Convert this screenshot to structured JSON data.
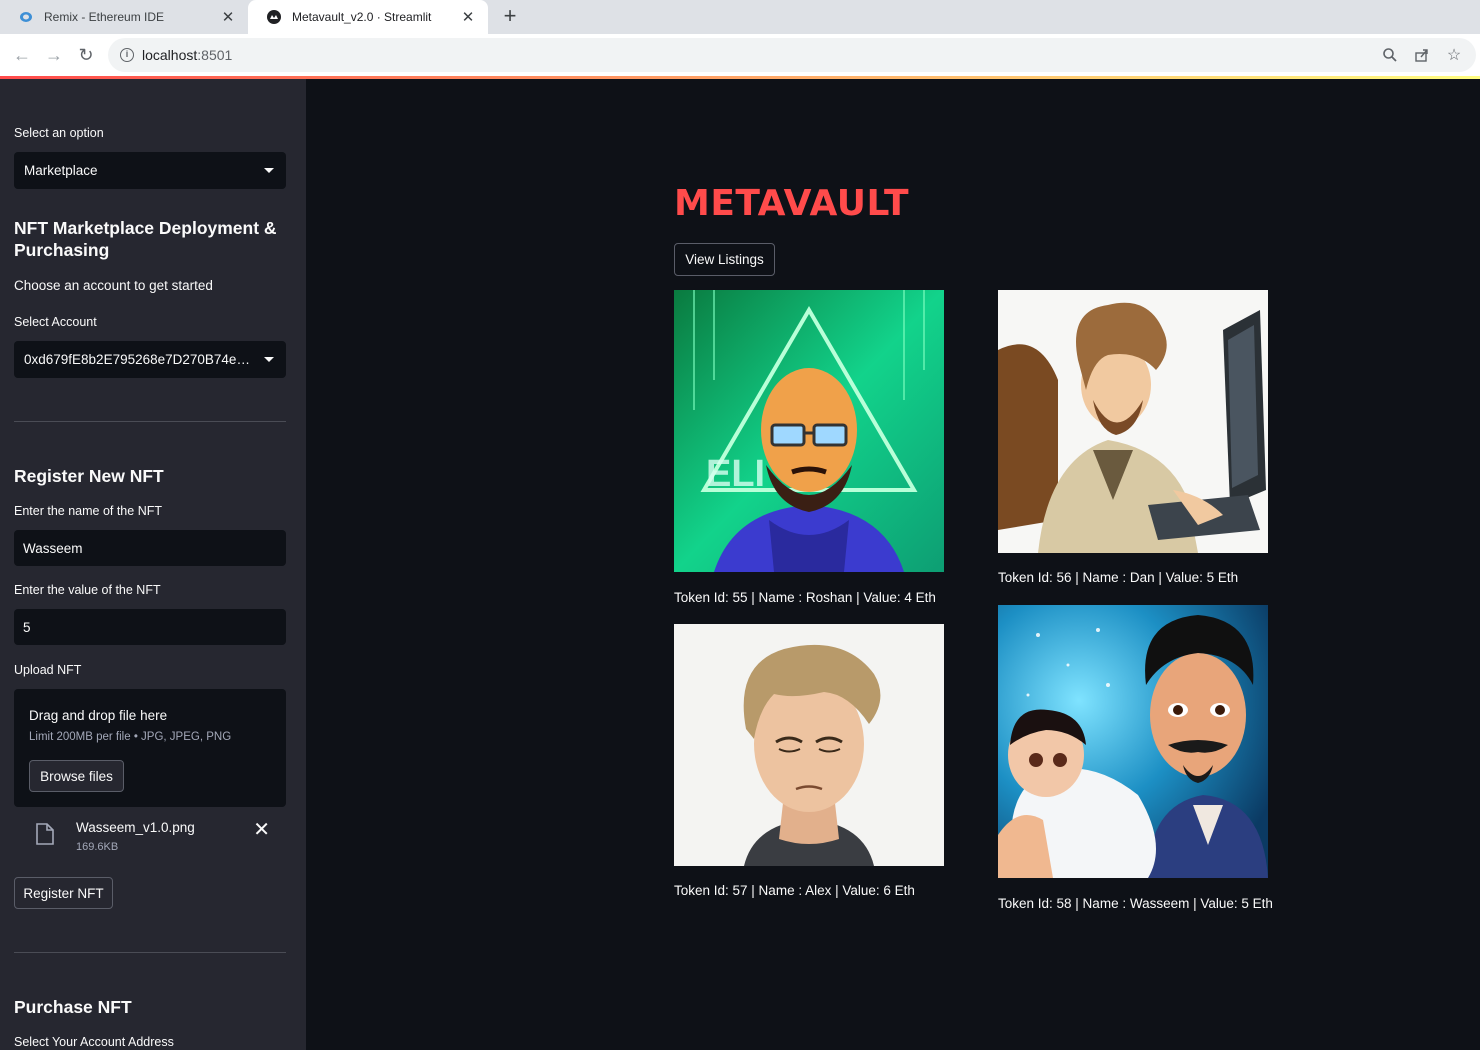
{
  "browser": {
    "tabs": [
      {
        "title": "Remix - Ethereum IDE",
        "active": false
      },
      {
        "title": "Metavault_v2.0 · Streamlit",
        "active": true
      }
    ],
    "url_host": "localhost",
    "url_port": ":8501"
  },
  "sidebar": {
    "option_label": "Select an option",
    "option_value": "Marketplace",
    "section_title": "NFT Marketplace Deployment & Purchasing",
    "intro": "Choose an account to get started",
    "account_label": "Select Account",
    "account_value": "0xd679fE8b2E795268e7D270B74eB...",
    "register": {
      "title": "Register New NFT",
      "name_label": "Enter the name of the NFT",
      "name_value": "Wasseem",
      "value_label": "Enter the value of the NFT",
      "value_value": "5",
      "upload_label": "Upload NFT",
      "dropzone_title": "Drag and drop file here",
      "dropzone_limit": "Limit 200MB per file • JPG, JPEG, PNG",
      "browse_label": "Browse files",
      "file_name": "Wasseem_v1.0.png",
      "file_size": "169.6KB",
      "button_label": "Register NFT"
    },
    "purchase": {
      "title": "Purchase NFT",
      "address_label": "Select Your Account Address"
    }
  },
  "main": {
    "title": "METAVAULT",
    "view_listings_label": "View Listings",
    "nfts": [
      {
        "caption": "Token Id: 55 | Name : Roshan | Value: 4 Eth"
      },
      {
        "caption": "Token Id: 56 | Name : Dan | Value: 5 Eth"
      },
      {
        "caption": "Token Id: 57 | Name : Alex | Value: 6 Eth"
      },
      {
        "caption": "Token Id: 58 | Name : Wasseem | Value: 5 Eth"
      }
    ]
  },
  "colors": {
    "accent": "#ff4b4b",
    "background": "#0e1117",
    "sidebar": "#262730"
  }
}
